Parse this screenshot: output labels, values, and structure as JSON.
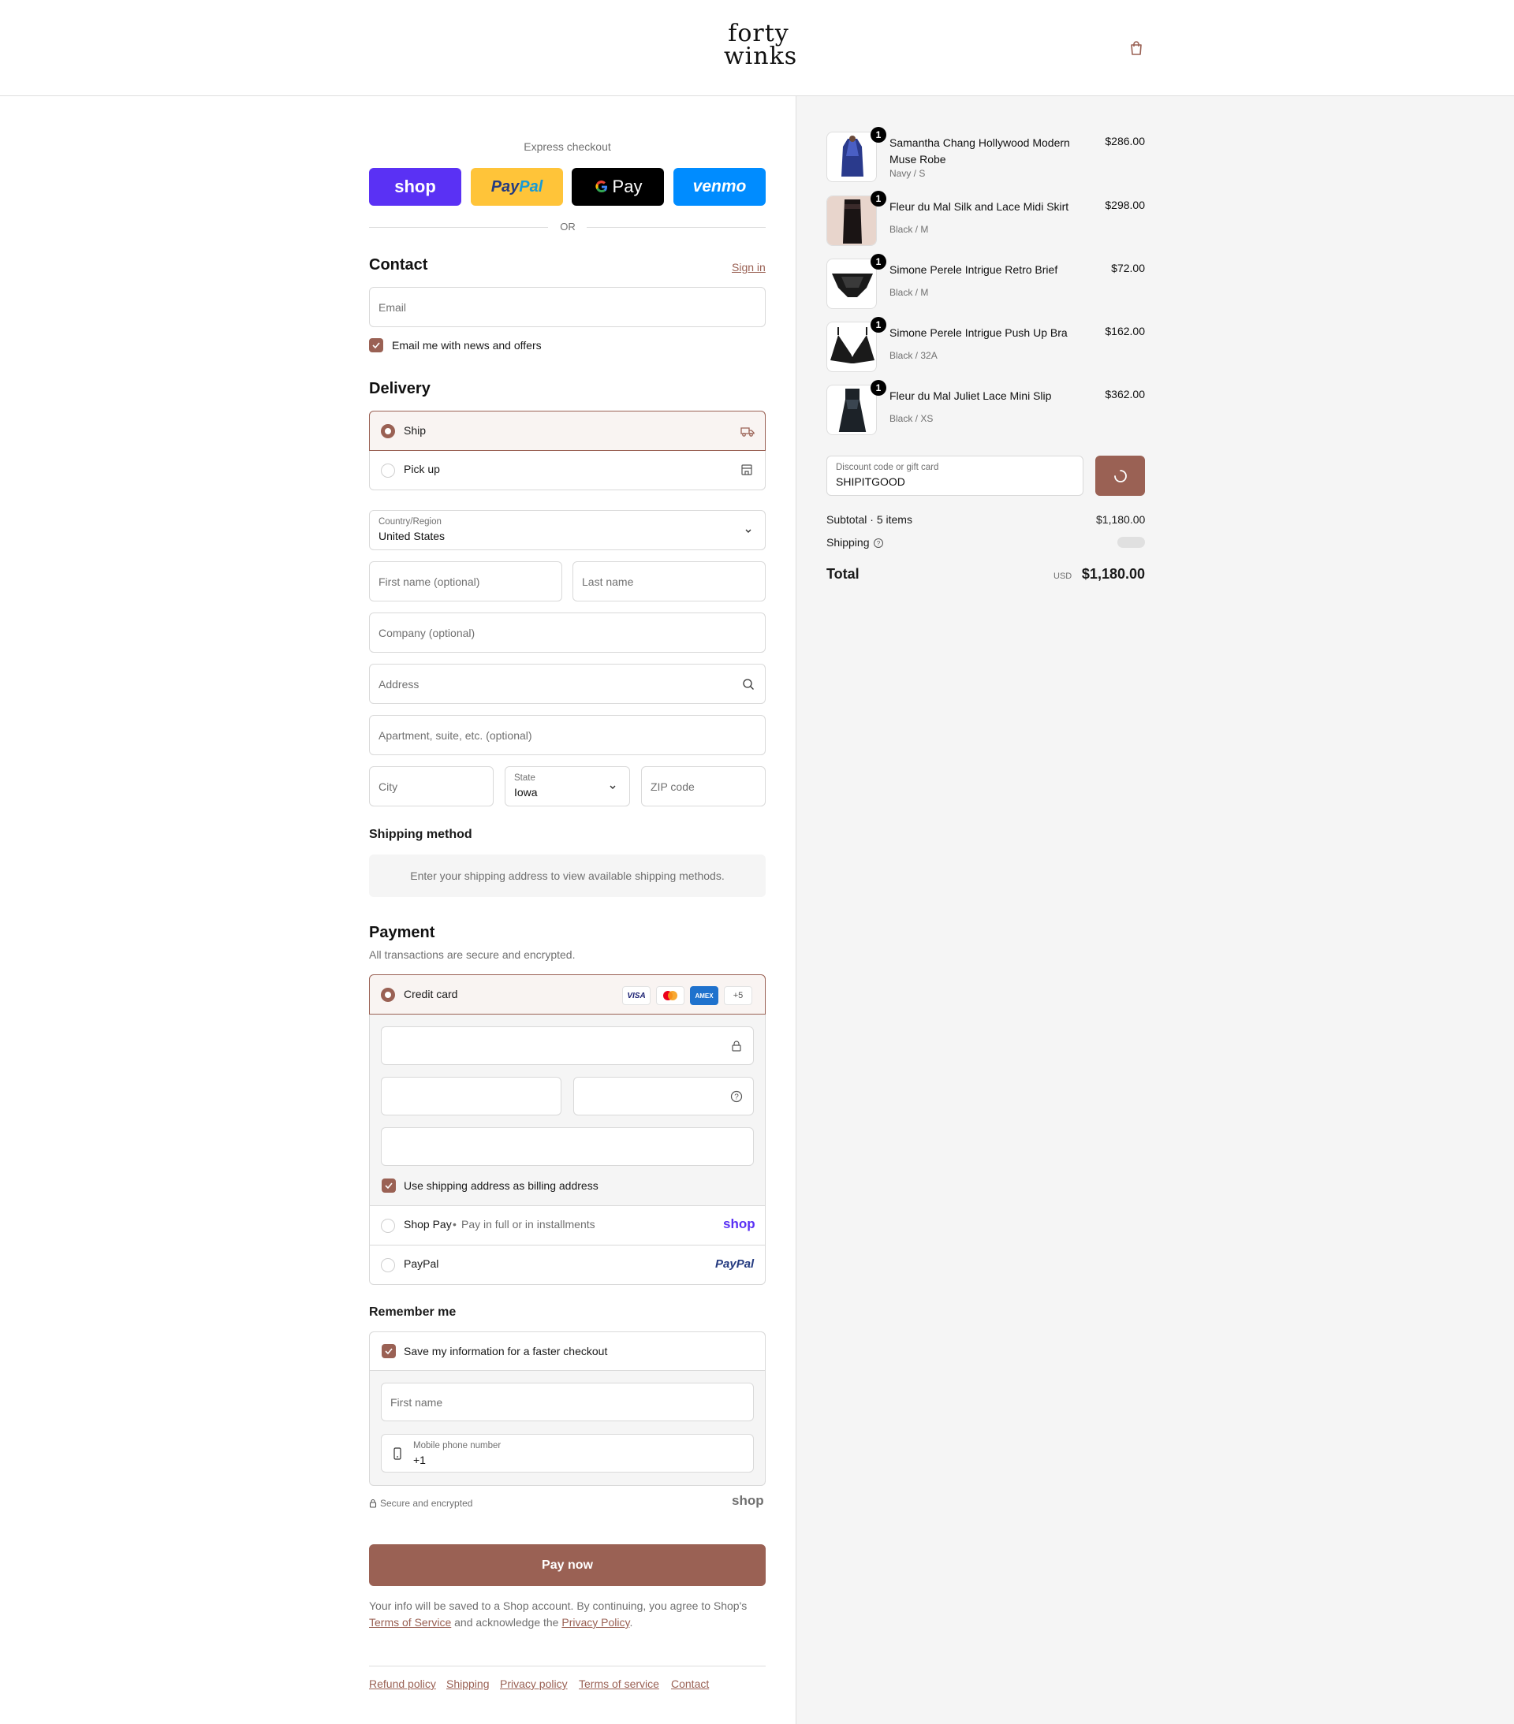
{
  "header": {
    "logo_line1": "forty",
    "logo_line2": "winks"
  },
  "express": {
    "title": "Express checkout",
    "shop": "shop",
    "paypal_pay": "Pay",
    "paypal_pal": "Pal",
    "gpay": "Pay",
    "venmo": "venmo",
    "or": "OR"
  },
  "contact": {
    "title": "Contact",
    "sign_in": "Sign in",
    "email_placeholder": "Email",
    "news_label": "Email me with news and offers"
  },
  "delivery": {
    "title": "Delivery",
    "ship": "Ship",
    "pickup": "Pick up",
    "country_label": "Country/Region",
    "country_value": "United States",
    "first_name": "First name (optional)",
    "last_name": "Last name",
    "company": "Company (optional)",
    "address": "Address",
    "apartment": "Apartment, suite, etc. (optional)",
    "city": "City",
    "state_label": "State",
    "state_value": "Iowa",
    "zip": "ZIP code"
  },
  "shipping_method": {
    "title": "Shipping method",
    "notice": "Enter your shipping address to view available shipping methods."
  },
  "payment": {
    "title": "Payment",
    "subtitle": "All transactions are secure and encrypted.",
    "credit_card": "Credit card",
    "cards": [
      "VISA",
      "AMEX"
    ],
    "more_cards": "+5",
    "billing_label": "Use shipping address as billing address",
    "shop_pay": "Shop Pay",
    "shop_pay_sub": "Pay in full or in installments",
    "shop_pay_logo": "shop",
    "paypal": "PayPal",
    "paypal_logo": "PayPal"
  },
  "remember": {
    "title": "Remember me",
    "save_label": "Save my information for a faster checkout",
    "first_name": "First name",
    "phone_label": "Mobile phone number",
    "phone_value": "+1",
    "secure": "Secure and encrypted",
    "shop_logo": "shop"
  },
  "pay_button": "Pay now",
  "legal": {
    "line1": "Your info will be saved to a Shop account. By continuing, you agree to Shop's",
    "terms": "Terms of Service",
    "mid": "and acknowledge the",
    "privacy": "Privacy Policy",
    "end": "."
  },
  "footer": {
    "links": [
      "Refund policy",
      "Shipping",
      "Privacy policy",
      "Terms of service",
      "Contact"
    ]
  },
  "order": {
    "items": [
      {
        "name": "Samantha Chang Hollywood Modern Muse Robe",
        "variant": "Navy / S",
        "price": "$286.00",
        "qty": "1"
      },
      {
        "name": "Fleur du Mal Silk and Lace Midi Skirt",
        "variant": "Black / M",
        "price": "$298.00",
        "qty": "1"
      },
      {
        "name": "Simone Perele Intrigue Retro Brief",
        "variant": "Black / M",
        "price": "$72.00",
        "qty": "1"
      },
      {
        "name": "Simone Perele Intrigue Push Up Bra",
        "variant": "Black / 32A",
        "price": "$162.00",
        "qty": "1"
      },
      {
        "name": "Fleur du Mal Juliet Lace Mini Slip",
        "variant": "Black / XS",
        "price": "$362.00",
        "qty": "1"
      }
    ],
    "discount_label": "Discount code or gift card",
    "discount_value": "SHIPITGOOD",
    "subtotal_label": "Subtotal · 5 items",
    "subtotal_value": "$1,180.00",
    "shipping_label": "Shipping",
    "total_label": "Total",
    "currency": "USD",
    "total_value": "$1,180.00"
  },
  "colors": {
    "accent": "#9a6154",
    "shop_purple": "#5a31f4",
    "paypal_yellow": "#ffc439",
    "venmo_blue": "#008cff"
  }
}
